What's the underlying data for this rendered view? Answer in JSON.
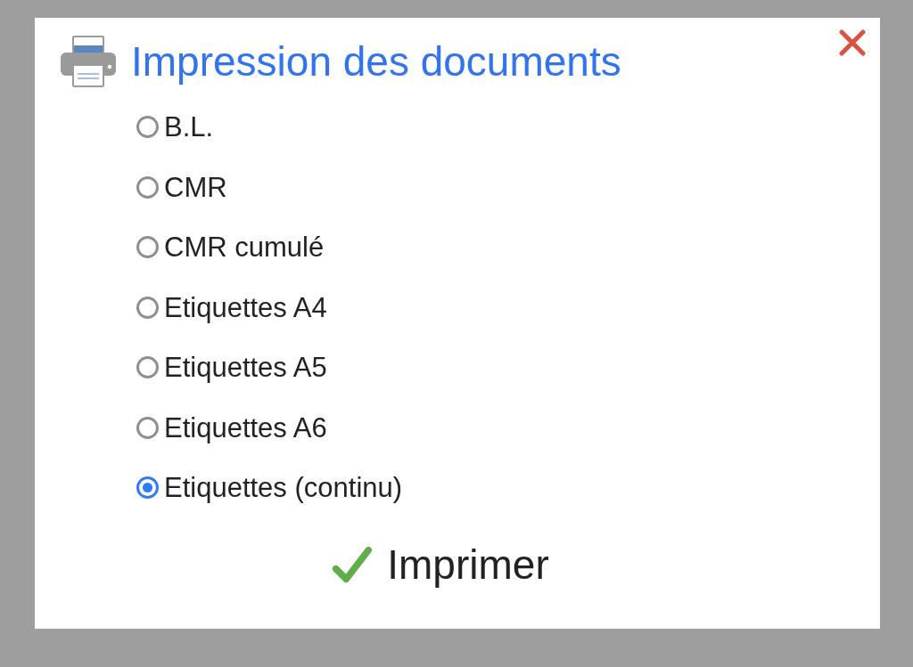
{
  "dialog": {
    "title": "Impression des documents",
    "options": [
      {
        "label": "B.L.",
        "selected": false
      },
      {
        "label": "CMR",
        "selected": false
      },
      {
        "label": "CMR cumulé",
        "selected": false
      },
      {
        "label": "Etiquettes A4",
        "selected": false
      },
      {
        "label": "Etiquettes A5",
        "selected": false
      },
      {
        "label": "Etiquettes A6",
        "selected": false
      },
      {
        "label": "Etiquettes (continu)",
        "selected": true
      }
    ],
    "print_button": {
      "label": "Imprimer"
    }
  }
}
